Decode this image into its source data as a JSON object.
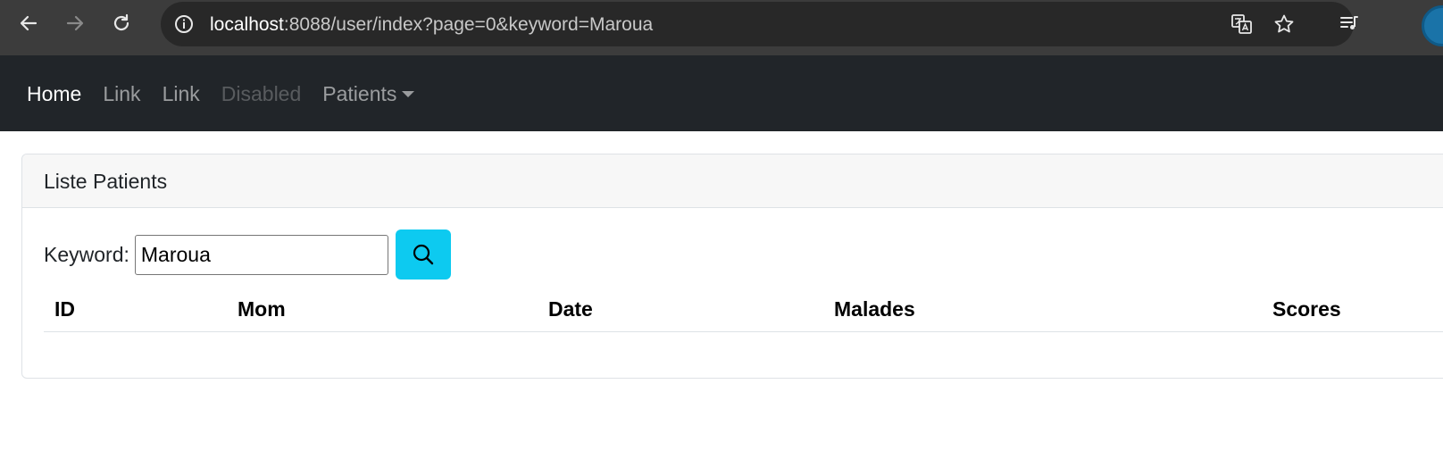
{
  "browser": {
    "url_host": "localhost",
    "url_rest": ":8088/user/index?page=0&keyword=Maroua",
    "icons": {
      "back": "arrow-left-icon",
      "forward": "arrow-right-icon",
      "reload": "reload-icon",
      "site_info": "info-icon",
      "translate": "translate-icon",
      "bookmark": "star-icon",
      "media": "media-queue-icon"
    }
  },
  "navbar": {
    "items": [
      {
        "label": "Home",
        "state": "active"
      },
      {
        "label": "Link",
        "state": "normal"
      },
      {
        "label": "Link",
        "state": "normal"
      },
      {
        "label": "Disabled",
        "state": "disabled"
      },
      {
        "label": "Patients",
        "state": "dropdown"
      }
    ]
  },
  "card": {
    "title": "Liste Patients",
    "search": {
      "label": "Keyword:",
      "value": "Maroua",
      "button_icon": "search-icon",
      "button_color": "#0dcaf0"
    },
    "table": {
      "headers": [
        "ID",
        "Mom",
        "Date",
        "Malades",
        "Scores"
      ],
      "rows": []
    }
  }
}
